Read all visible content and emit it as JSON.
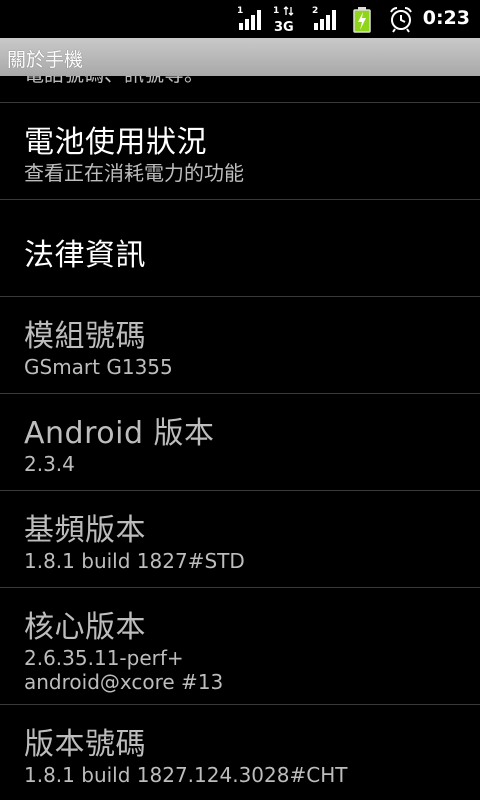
{
  "status_bar": {
    "time": "0:23",
    "sim1_label": "1",
    "sim2_label": "1",
    "sim3_label": "2",
    "network_type": "3G",
    "battery_color": "#8fd61b",
    "icons": [
      "signal-1-icon",
      "signal-3g-icon",
      "signal-2-icon",
      "battery-charging-icon",
      "alarm-clock-icon"
    ]
  },
  "title_bar": {
    "title": "關於手機"
  },
  "list": {
    "cut_summary": "電話號碼、訊號等。",
    "items": [
      {
        "title": "電池使用狀況",
        "summary": "查看正在消耗電力的功能"
      },
      {
        "title": "法律資訊",
        "summary": ""
      },
      {
        "title": "模組號碼",
        "summary": "GSmart G1355"
      },
      {
        "title": "Android 版本",
        "summary": "2.3.4"
      },
      {
        "title": "基頻版本",
        "summary": "1.8.1  build 1827#STD"
      },
      {
        "title": "核心版本",
        "summary": "2.6.35.11-perf+",
        "summary2": "android@xcore #13"
      },
      {
        "title": "版本號碼",
        "summary": "1.8.1  build 1827.124.3028#CHT"
      }
    ]
  }
}
